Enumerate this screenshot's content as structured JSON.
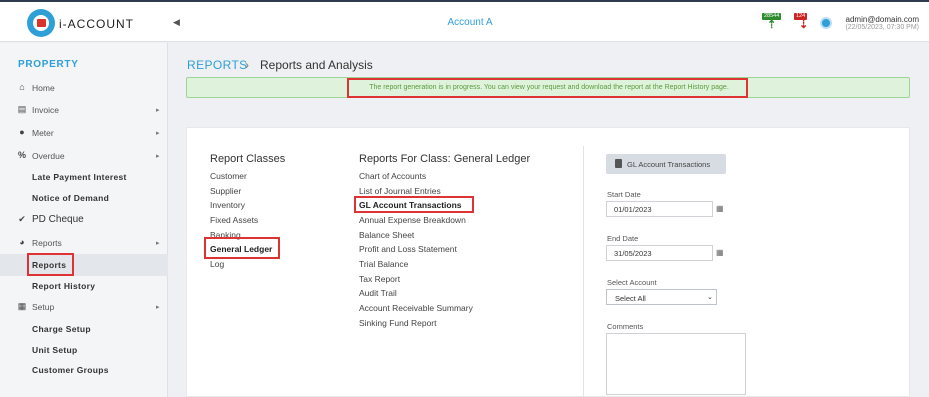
{
  "app": {
    "title": "i-ACCOUNT",
    "account": "Account A"
  },
  "header": {
    "badges": [
      {
        "count": "28544",
        "color": "#2e8b2e"
      },
      {
        "count": "124",
        "color": "#cc2222"
      }
    ],
    "user_email": "admin@domain.com",
    "user_time": "(22/05/2023, 07:30 PM)"
  },
  "sidebar": {
    "title": "PROPERTY",
    "items": [
      {
        "label": "Home",
        "icon": "home-icon"
      },
      {
        "label": "Invoice",
        "icon": "invoice-icon"
      },
      {
        "label": "Meter",
        "icon": "drop-icon"
      },
      {
        "label": "Overdue",
        "icon": "percent-icon"
      },
      {
        "label": "Late Payment Interest"
      },
      {
        "label": "Notice of Demand"
      },
      {
        "label": "PD Cheque",
        "icon": "check-icon"
      },
      {
        "label": "Reports",
        "icon": "pie-chart-icon"
      },
      {
        "label": "Reports"
      },
      {
        "label": "Report History"
      },
      {
        "label": "Setup",
        "icon": "grid-icon"
      },
      {
        "label": "Charge Setup"
      },
      {
        "label": "Unit Setup"
      },
      {
        "label": "Customer Groups"
      }
    ]
  },
  "breadcrumb": {
    "root": "REPORTS",
    "separator": "›",
    "current": "Reports and Analysis"
  },
  "alert": {
    "text": "The report generation is in progress. You can view your request and download the report at the Report History page."
  },
  "report_classes": {
    "title": "Report Classes",
    "items": [
      "Customer",
      "Supplier",
      "Inventory",
      "Fixed Assets",
      "Banking",
      "General Ledger",
      "Log"
    ],
    "selected": "General Ledger"
  },
  "reports_for_class": {
    "title": "Reports For Class:  General Ledger",
    "items": [
      "Chart of Accounts",
      "List of Journal Entries",
      "GL Account Transactions",
      "Annual Expense Breakdown",
      "Balance Sheet",
      "Profit and Loss Statement",
      "Trial Balance",
      "Tax Report",
      "Audit Trail",
      "Account Receivable Summary",
      "Sinking Fund Report"
    ],
    "selected": "GL Account Transactions"
  },
  "form": {
    "button_label": "GL Account Transactions",
    "start_date_label": "Start Date",
    "start_date": "01/01/2023",
    "end_date_label": "End Date",
    "end_date": "31/05/2023",
    "account_label": "Select Account",
    "account_value": "Select All",
    "comments_label": "Comments"
  },
  "colors": {
    "accent": "#2f9fd8",
    "highlight": "#d33333",
    "alert_bg": "#dff3dc",
    "alert_text": "#5a9b3c"
  }
}
